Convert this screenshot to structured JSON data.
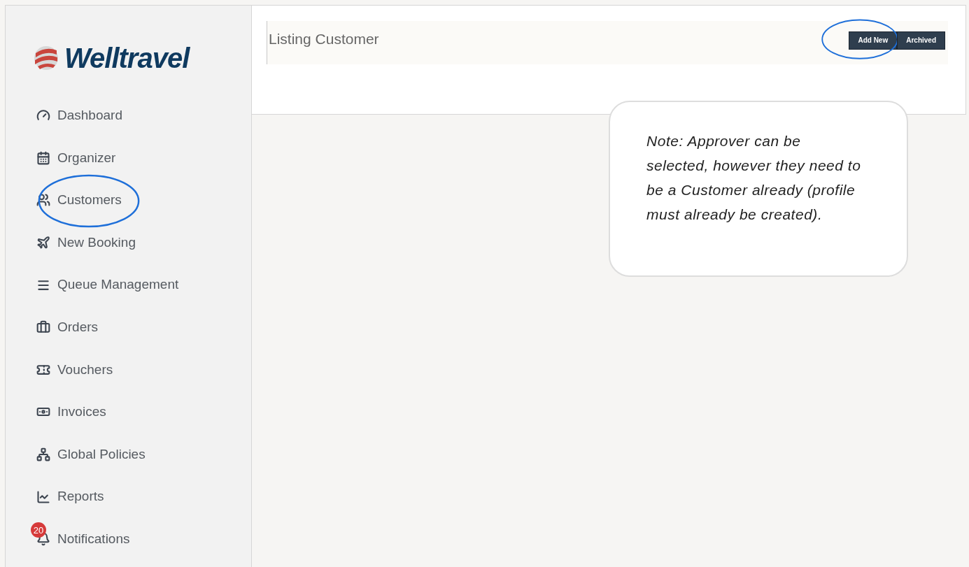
{
  "logo": {
    "text": "Welltravel"
  },
  "sidebar": {
    "items": [
      {
        "kind": "gauge",
        "label": "Dashboard",
        "circled": false
      },
      {
        "kind": "calendar",
        "label": "Organizer",
        "circled": false
      },
      {
        "kind": "users",
        "label": "Customers",
        "circled": true
      },
      {
        "kind": "plane",
        "label": "New Booking",
        "circled": false
      },
      {
        "kind": "list",
        "label": "Queue Management",
        "circled": false
      },
      {
        "kind": "briefcase",
        "label": "Orders",
        "circled": false
      },
      {
        "kind": "ticket",
        "label": "Vouchers",
        "circled": false
      },
      {
        "kind": "money",
        "label": "Invoices",
        "circled": false
      },
      {
        "kind": "hierarchy",
        "label": "Global Policies",
        "circled": false
      },
      {
        "kind": "chart",
        "label": "Reports",
        "circled": false
      },
      {
        "kind": "bell",
        "label": "Notifications",
        "circled": false,
        "badge": "20"
      }
    ]
  },
  "header": {
    "title": "Listing Customer",
    "buttons": [
      {
        "label": "Add New",
        "circled": true
      },
      {
        "label": "Archived",
        "circled": false
      }
    ]
  },
  "note": {
    "text": "Note: Approver can be selected, however they need to be a Customer already (profile must already be created)."
  }
}
